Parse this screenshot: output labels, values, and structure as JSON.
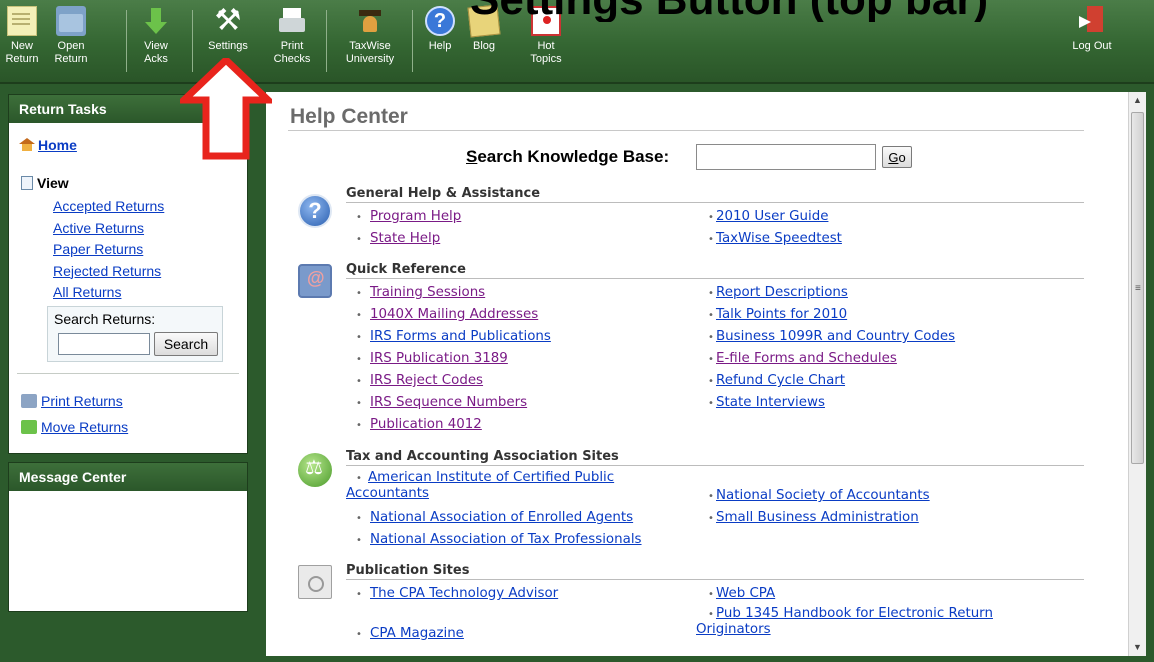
{
  "slide_title": "Settings Button (top bar)",
  "toolbar": {
    "buttons": [
      {
        "line1": "New",
        "line2": "Return",
        "icon": "new-return-icon"
      },
      {
        "line1": "Open",
        "line2": "Return",
        "icon": "open-return-icon"
      },
      {
        "line1": "View",
        "line2": "Acks",
        "icon": "view-acks-icon"
      },
      {
        "line1": "Settings",
        "line2": "",
        "icon": "settings-icon"
      },
      {
        "line1": "Print",
        "line2": "Checks",
        "icon": "print-checks-icon"
      },
      {
        "line1": "TaxWise",
        "line2": "University",
        "icon": "university-icon"
      },
      {
        "line1": "Help",
        "line2": "",
        "icon": "help-icon"
      },
      {
        "line1": "Blog",
        "line2": "",
        "icon": "blog-icon"
      },
      {
        "line1": "Hot",
        "line2": "Topics",
        "icon": "hot-topics-icon"
      },
      {
        "line1": "Log Out",
        "line2": "",
        "icon": "log-out-icon"
      }
    ]
  },
  "annotation": {
    "color": "#e8241c",
    "points_to": "settings-button"
  },
  "return_tasks": {
    "title": "Return Tasks",
    "home": "Home",
    "view_label": "View",
    "views": [
      "Accepted Returns",
      "Active Returns",
      "Paper Returns",
      "Rejected Returns",
      "All Returns"
    ],
    "search_label": "Search Returns:",
    "search_value": "",
    "search_button": "Search",
    "print_returns": "Print Returns",
    "move_returns": "Move Returns"
  },
  "message_center": {
    "title": "Message Center"
  },
  "main": {
    "title": "Help Center",
    "kb_label_initial": "S",
    "kb_label_rest": "earch Knowledge Base:",
    "kb_value": "",
    "go_initial": "G",
    "go_rest": "o",
    "sections": [
      {
        "title": "General Help & Assistance",
        "icon": "help-circle-icon",
        "left": [
          "Program Help",
          "State Help"
        ],
        "right": [
          "2010 User Guide",
          "TaxWise Speedtest"
        ]
      },
      {
        "title": "Quick Reference",
        "icon": "address-book-icon",
        "left": [
          "Training Sessions",
          "1040X Mailing Addresses",
          "IRS Forms and Publications",
          "IRS Publication 3189",
          "IRS Reject Codes",
          "IRS Sequence Numbers",
          "Publication 4012"
        ],
        "right": [
          "Report Descriptions",
          "Talk Points for 2010",
          "Business 1099R and Country Codes",
          "E-file Forms and Schedules",
          "Refund Cycle Chart",
          "State Interviews"
        ]
      },
      {
        "title": "Tax and Accounting Association Sites",
        "icon": "scales-icon",
        "left": [
          "American Institute of Certified Public",
          "Accountants",
          "National Association of Enrolled Agents",
          "National Association of Tax Professionals"
        ],
        "right": [
          "National Society of Accountants",
          "Small Business Administration"
        ]
      },
      {
        "title": "Publication Sites",
        "icon": "publication-icon",
        "left": [
          "The CPA Technology Advisor",
          "CPA Magazine"
        ],
        "right": [
          "Web CPA",
          "Pub 1345 Handbook for Electronic Return",
          "Originators"
        ]
      }
    ]
  }
}
